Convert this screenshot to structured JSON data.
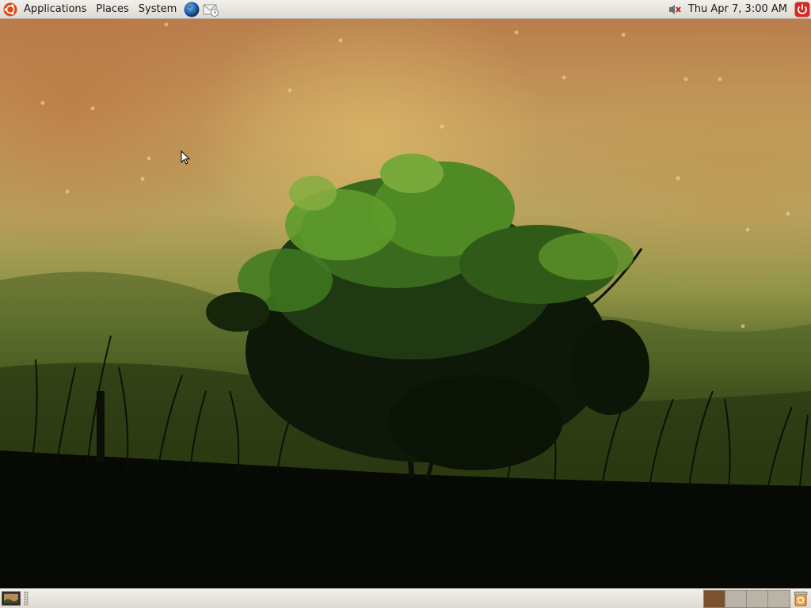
{
  "top_panel": {
    "menus": [
      "Applications",
      "Places",
      "System"
    ],
    "launchers": [
      "web-browser-icon",
      "mail-client-icon"
    ],
    "clock": "Thu Apr  7,  3:00 AM",
    "tray_icons": [
      "speaker-muted-icon",
      "shutdown-icon"
    ]
  },
  "desktop": {
    "wallpaper": "tree-silhouette-grass-autumn-sky",
    "cursor": "arrow-pointer-icon"
  },
  "bottom_panel": {
    "show_desktop_icon": "show-desktop-icon",
    "workspaces": [
      {
        "active": true,
        "color": "#7a5230"
      },
      {
        "active": false,
        "color": "#b9b3a8"
      },
      {
        "active": false,
        "color": "#b9b3a8"
      },
      {
        "active": false,
        "color": "#b9b3a8"
      }
    ],
    "trash_icon": "trash-icon"
  },
  "colors": {
    "panel_bg": "#e6e3dd",
    "ubuntu_orange": "#dd4814",
    "shutdown_red": "#d42a1f"
  }
}
